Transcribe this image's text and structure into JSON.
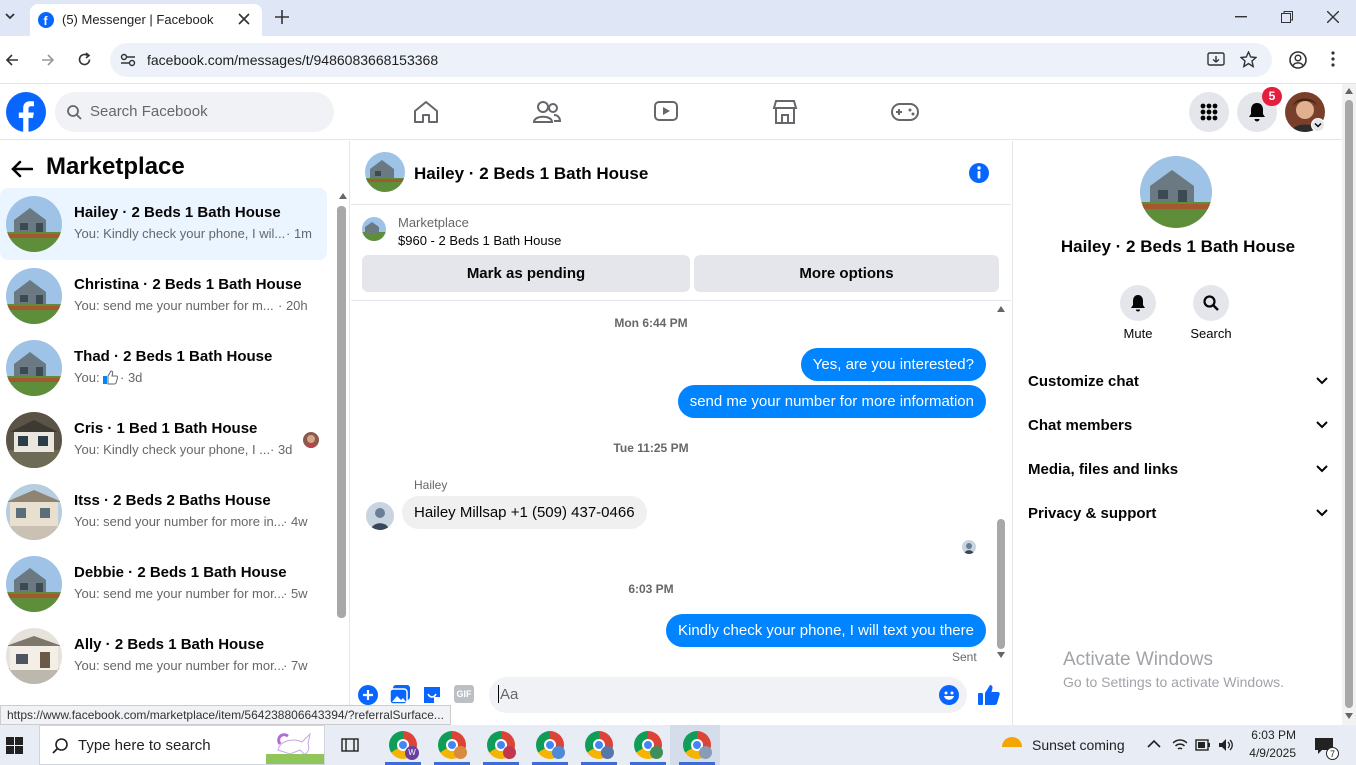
{
  "browser": {
    "tab_title": "(5) Messenger | Facebook",
    "url": "facebook.com/messages/t/9486083668153368"
  },
  "fb": {
    "search_placeholder": "Search Facebook",
    "notification_count": "5"
  },
  "left": {
    "title": "Marketplace",
    "conversations": [
      {
        "name": "Hailey · 2 Beds 1 Bath House",
        "preview": "You: Kindly check your phone, I wil...",
        "time": "· 1m",
        "active": true
      },
      {
        "name": "Christina · 2 Beds 1 Bath House",
        "preview": "You: send me your number for m...",
        "time": "· 20h"
      },
      {
        "name": "Thad · 2 Beds 1 Bath House",
        "preview": "You:",
        "time": "· 3d"
      },
      {
        "name": "Cris · 1 Bed 1 Bath House",
        "preview": "You: Kindly check your phone, I ...",
        "time": "· 3d"
      },
      {
        "name": "Itss · 2 Beds 2 Baths House",
        "preview": "You: send your number for more in...",
        "time": "· 4w"
      },
      {
        "name": "Debbie · 2 Beds 1 Bath House",
        "preview": "You: send me your number for mor...",
        "time": "· 5w"
      },
      {
        "name": "Ally · 2 Beds 1 Bath House",
        "preview": "You: send me your number for mor...",
        "time": "· 7w"
      }
    ],
    "status_url": "https://www.facebook.com/marketplace/item/564238806643394/?referralSurface..."
  },
  "chat": {
    "title": "Hailey · 2 Beds 1 Bath House",
    "marketplace_label": "Marketplace",
    "listing": "$960 - 2 Beds 1 Bath House",
    "mark_pending": "Mark as pending",
    "more_options": "More options",
    "time1": "Mon 6:44 PM",
    "msg1": "Yes, are you interested?",
    "msg2": "send me your number for more information",
    "time2": "Tue 11:25 PM",
    "sender": "Hailey",
    "msg3": "Hailey Millsap +1 (509) 437-0466",
    "time3": "6:03 PM",
    "msg4": "Kindly check your phone, I will text you there",
    "sent": "Sent",
    "input_placeholder": "Aa",
    "gif_label": "GIF"
  },
  "right": {
    "name": "Hailey · 2 Beds 1 Bath House",
    "mute": "Mute",
    "search": "Search",
    "sections": [
      "Customize chat",
      "Chat members",
      "Media, files and links",
      "Privacy & support"
    ],
    "activate_title": "Activate Windows",
    "activate_sub": "Go to Settings to activate Windows."
  },
  "taskbar": {
    "search_placeholder": "Type here to search",
    "weather": "Sunset coming",
    "time": "6:03 PM",
    "date": "4/9/2025",
    "notif_count": "7"
  },
  "colors": {
    "accent": "#0084ff",
    "fb_blue": "#0866ff",
    "badge_red": "#e41e3f"
  }
}
